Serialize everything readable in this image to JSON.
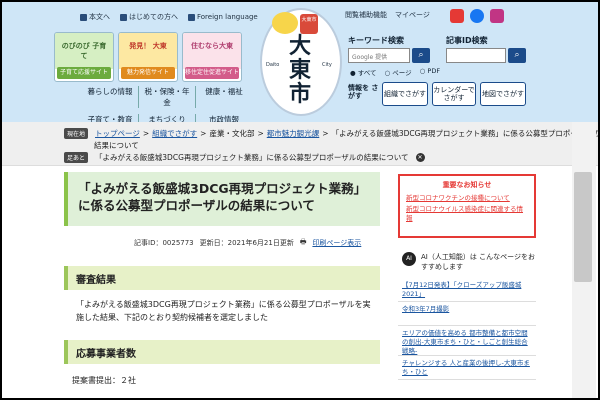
{
  "header": {
    "top_links": [
      "本文へ",
      "はじめての方へ",
      "Foreign language"
    ],
    "right_links": [
      "閲覧補助機能",
      "マイページ"
    ],
    "banners": [
      {
        "title": "のびのび 子育て",
        "label": "子育て応援サイト",
        "color": "#6cab3e"
      },
      {
        "title": "発見！ 大東",
        "label": "魅力発信サイト",
        "color": "#e08a1e"
      },
      {
        "title": "住むなら大東",
        "label": "移住定住促進サイト",
        "color": "#d35c8a"
      }
    ],
    "nav": [
      [
        "暮らしの情報",
        "税・保険・年金",
        "健康・福祉"
      ],
      [
        "子育て・教育",
        "まちづくり",
        "市政情報"
      ]
    ],
    "logo": {
      "main": "大東市",
      "daito": "Daito",
      "city": "City",
      "badge": "大東市"
    },
    "keyword_search": {
      "label": "キーワード検索",
      "placeholder": "Google 提供",
      "button": "検索",
      "options": [
        "すべて",
        "ページ",
        "PDF"
      ]
    },
    "id_search": {
      "label": "記事ID検索",
      "button": "検索"
    },
    "info_label": "情報を さがす",
    "search_buttons": [
      "組織でさがす",
      "カレンダーで さがす",
      "地図でさがす"
    ]
  },
  "breadcrumb": {
    "current_label": "現在地",
    "items": [
      "トップページ",
      "組織でさがす",
      "産業・文化部",
      "都市魅力観光課"
    ],
    "last": "「よみがえる飯盛城3DCG再現プロジェクト業務」に係る公募型プロポーザルの",
    "last_cont": "結果について",
    "history_label": "足あと",
    "history_item": "「よみがえる飯盛城3DCG再現プロジェクト業務」に係る公募型プロポーザルの結果について"
  },
  "article": {
    "title": "「よみがえる飯盛城3DCG再現プロジェクト業務」に係る公募型プロポーザルの結果について",
    "id_text": "記事ID：0025773",
    "updated": "更新日：2021年6月21日更新",
    "print": "印刷ページ表示",
    "section1": "審査結果",
    "section1_text": "「よみがえる飯盛城3DCG再現プロジェクト業務」に係る公募型プロポーザルを実施した結果、下記のとおり契約候補者を選定しました",
    "section2": "応募事業者数",
    "count": "提案書提出：２社"
  },
  "sidebar": {
    "notice_title": "重要なお知らせ",
    "notices": [
      "新型コロナワクチンの接種について",
      "新型コロナウイルス感染症に関連する情報"
    ],
    "ai_badge": "AI",
    "ai_text": "AI（人工知能）は こんなページをおすすめします",
    "recommendations": [
      "【7月12日発表】「クローズアップ飯盛城2021」",
      "令和3年7月撮影",
      "エリアの価値を高める 都市整備と都市空間の創出-大東市まち・ひと・しごと創生総合戦略-",
      "チャレンジする 人と産業の後押し-大東市まち・ひと"
    ]
  }
}
